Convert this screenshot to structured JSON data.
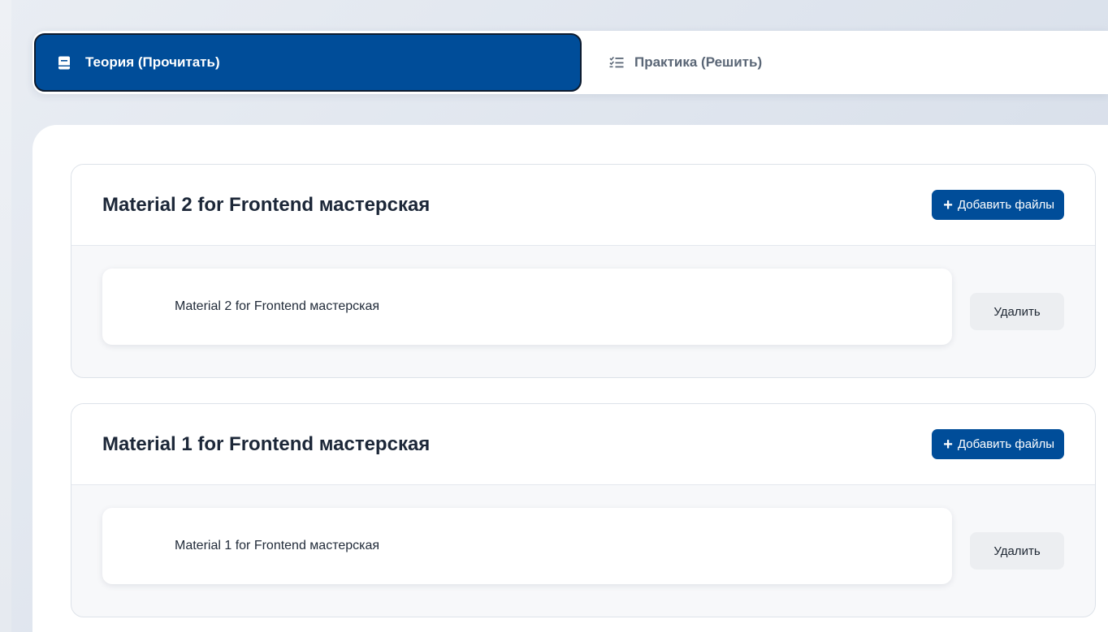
{
  "tabs": [
    {
      "label": "Теория (Прочитать)",
      "icon": "book-icon",
      "active": true
    },
    {
      "label": "Практика (Решить)",
      "icon": "checklist-icon",
      "active": false
    }
  ],
  "materials": [
    {
      "title": "Material 2 for Frontend мастерская",
      "add_label": "Добавить файлы",
      "file_name": "Material 2 for Frontend мастерская",
      "delete_label": "Удалить"
    },
    {
      "title": "Material 1 for Frontend мастерская",
      "add_label": "Добавить файлы",
      "file_name": "Material 1 for Frontend мастерская",
      "delete_label": "Удалить"
    }
  ],
  "colors": {
    "accent": "#004d99",
    "background": "#dfe5ee",
    "delete_button": "#eceef1"
  }
}
